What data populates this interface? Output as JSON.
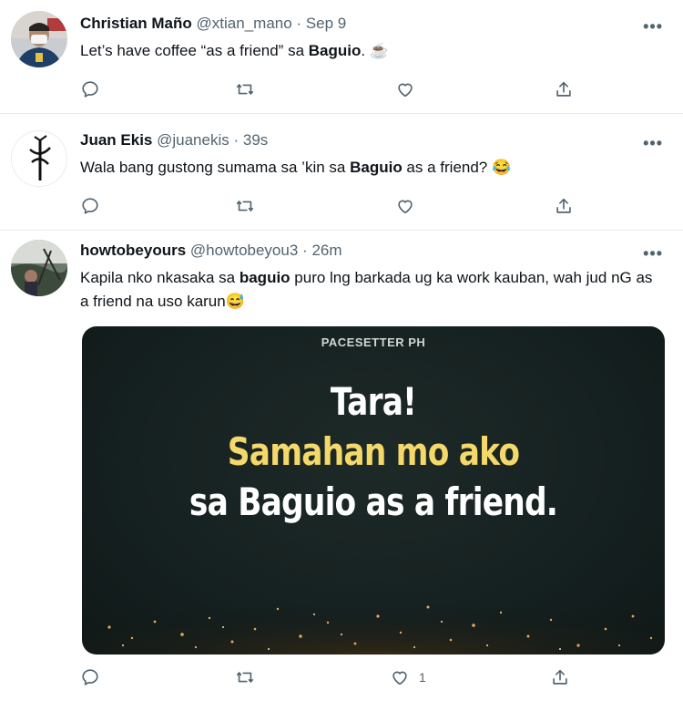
{
  "tweets": [
    {
      "name": "Christian Maño",
      "handle": "@xtian_mano",
      "time": "Sep 9",
      "text_before": "Let’s have coffee “as a friend” sa ",
      "text_bold": "Baguio",
      "text_after": ". ☕",
      "like_count": ""
    },
    {
      "name": "Juan Ekis",
      "handle": "@juanekis",
      "time": "39s",
      "text_before": "Wala bang gustong sumama sa ’kin sa ",
      "text_bold": "Baguio",
      "text_after": " as a friend? 😂",
      "like_count": ""
    },
    {
      "name": "howtobeyours",
      "handle": "@howtobeyou3",
      "time": "26m",
      "text_before": "Kapila nko nkasaka sa ",
      "text_bold": "baguio",
      "text_after": " puro lng barkada ug ka work kauban, wah jud nG as a friend na uso karun😅",
      "like_count": "1",
      "media": {
        "brand": "PACESETTER PH",
        "line1": "Tara!",
        "line2": "Samahan mo ako",
        "line3": "sa Baguio as a friend."
      }
    }
  ],
  "separator": "·",
  "more_label": "•••",
  "icons": [
    "reply-icon",
    "retweet-icon",
    "like-icon",
    "share-icon",
    "more-icon"
  ],
  "colors": {
    "text": "#0f1419",
    "secondary": "#536471",
    "divider": "#e6ecf0",
    "highlight": "#f4d86a"
  }
}
